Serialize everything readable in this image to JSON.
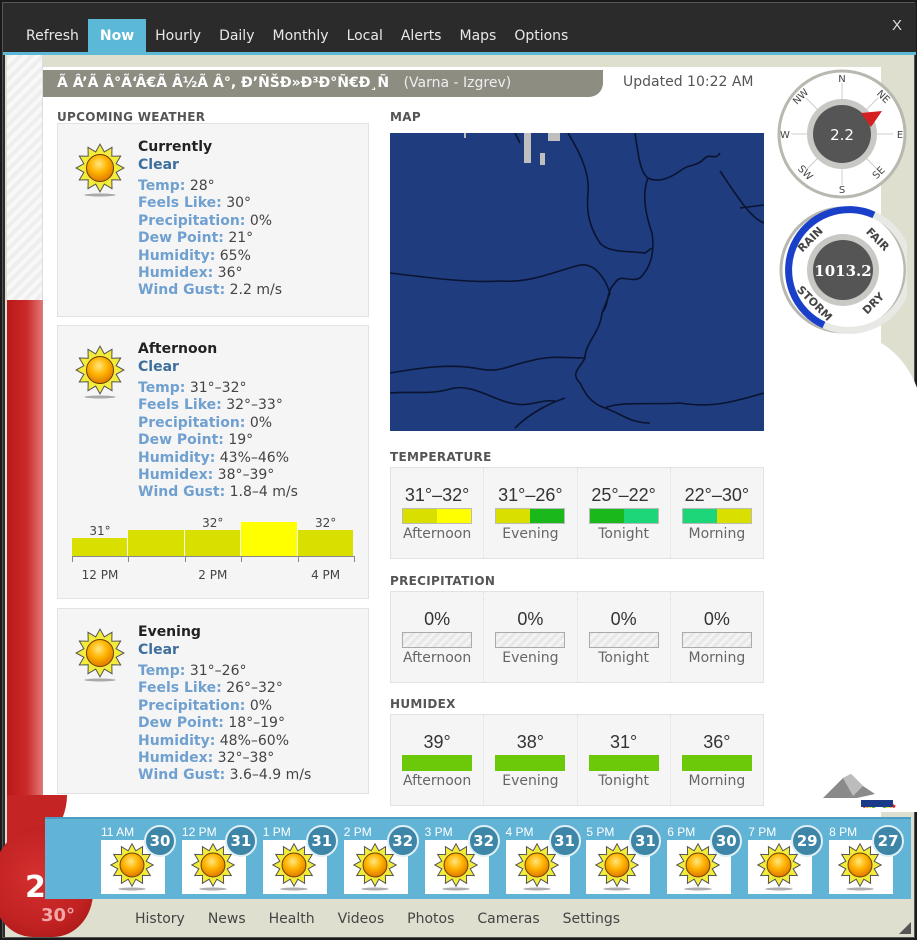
{
  "window": {
    "close_label": "X"
  },
  "nav": {
    "items": [
      {
        "label": "Refresh",
        "active": false
      },
      {
        "label": "Now",
        "active": true
      },
      {
        "label": "Hourly",
        "active": false
      },
      {
        "label": "Daily",
        "active": false
      },
      {
        "label": "Monthly",
        "active": false
      },
      {
        "label": "Local",
        "active": false
      },
      {
        "label": "Alerts",
        "active": false
      },
      {
        "label": "Maps",
        "active": false
      },
      {
        "label": "Options",
        "active": false
      }
    ]
  },
  "location": {
    "name": "Ã Â’Ã Â°Ã‘Â€Ã Â½Ã Â°, Ð’ÑŠÐ»Ð³Ð°Ñ€Ð¸Ñ",
    "sub": "(Varna - Izgrev)",
    "updated": "Updated 10:22 AM"
  },
  "current": {
    "temp": "28°",
    "feels_like": "30°"
  },
  "upcoming": {
    "title": "UPCOMING WEATHER",
    "cards": [
      {
        "period": "Currently",
        "condition": "Clear",
        "icon": "sun-icon",
        "rows": [
          {
            "label": "Temp:",
            "value": "28°"
          },
          {
            "label": "Feels Like:",
            "value": "30°"
          },
          {
            "label": "Precipitation:",
            "value": "0%"
          },
          {
            "label": "Dew Point:",
            "value": "21°"
          },
          {
            "label": "Humidity:",
            "value": "65%"
          },
          {
            "label": "Humidex:",
            "value": "36°"
          },
          {
            "label": "Wind Gust:",
            "value": "2.2 m/s"
          }
        ]
      },
      {
        "period": "Afternoon",
        "condition": "Clear",
        "icon": "sun-icon",
        "rows": [
          {
            "label": "Temp:",
            "value": "31°–32°"
          },
          {
            "label": "Feels Like:",
            "value": "32°–33°"
          },
          {
            "label": "Precipitation:",
            "value": "0%"
          },
          {
            "label": "Dew Point:",
            "value": "19°"
          },
          {
            "label": "Humidity:",
            "value": "43%–46%"
          },
          {
            "label": "Humidex:",
            "value": "38°–39°"
          },
          {
            "label": "Wind Gust:",
            "value": "1.8–4 m/s"
          }
        ],
        "hourly_bars": {
          "values": [
            31,
            32,
            32,
            33,
            32
          ],
          "labels": [
            "31°",
            "",
            "32°",
            "",
            "32°"
          ],
          "colors": [
            "#d9e000",
            "#d9e000",
            "#d9e000",
            "#ffff00",
            "#d9e000"
          ],
          "times": [
            "12 PM",
            "2 PM",
            "4 PM"
          ]
        }
      },
      {
        "period": "Evening",
        "condition": "Clear",
        "icon": "sun-icon",
        "rows": [
          {
            "label": "Temp:",
            "value": "31°–26°"
          },
          {
            "label": "Feels Like:",
            "value": "26°–32°"
          },
          {
            "label": "Precipitation:",
            "value": "0%"
          },
          {
            "label": "Dew Point:",
            "value": "18°–19°"
          },
          {
            "label": "Humidity:",
            "value": "48%–60%"
          },
          {
            "label": "Humidex:",
            "value": "32°–38°"
          },
          {
            "label": "Wind Gust:",
            "value": "3.6–4.9 m/s"
          }
        ]
      }
    ]
  },
  "map": {
    "title": "MAP"
  },
  "temperature": {
    "title": "TEMPERATURE",
    "cells": [
      {
        "value": "31°–32°",
        "label": "Afternoon",
        "colors": [
          "#d9e000",
          "#ffff00"
        ]
      },
      {
        "value": "31°–26°",
        "label": "Evening",
        "colors": [
          "#d9e000",
          "#1bb81b"
        ]
      },
      {
        "value": "25°–22°",
        "label": "Tonight",
        "colors": [
          "#1bb81b",
          "#1ed67a"
        ]
      },
      {
        "value": "22°–30°",
        "label": "Morning",
        "colors": [
          "#1ed67a",
          "#d9e000"
        ]
      }
    ]
  },
  "precipitation": {
    "title": "PRECIPITATION",
    "cells": [
      {
        "value": "0%",
        "label": "Afternoon"
      },
      {
        "value": "0%",
        "label": "Evening"
      },
      {
        "value": "0%",
        "label": "Tonight"
      },
      {
        "value": "0%",
        "label": "Morning"
      }
    ]
  },
  "humidex": {
    "title": "HUMIDEX",
    "cells": [
      {
        "value": "39°",
        "label": "Afternoon",
        "color": "#6cc90a"
      },
      {
        "value": "38°",
        "label": "Evening",
        "color": "#6cc90a"
      },
      {
        "value": "31°",
        "label": "Tonight",
        "color": "#6cc90a"
      },
      {
        "value": "36°",
        "label": "Morning",
        "color": "#6cc90a"
      }
    ]
  },
  "wind": {
    "speed": "2.2",
    "direction": "NE",
    "compass_labels": [
      "N",
      "NE",
      "E",
      "SE",
      "S",
      "SW",
      "W",
      "NW"
    ]
  },
  "pressure": {
    "value": "1013.2",
    "labels": [
      "RAIN",
      "FAIR",
      "STORM",
      "DRY"
    ]
  },
  "hourly": [
    {
      "time": "11 AM",
      "temp": "30",
      "icon": "sun-icon"
    },
    {
      "time": "12 PM",
      "temp": "31",
      "icon": "sun-icon"
    },
    {
      "time": "1 PM",
      "temp": "31",
      "icon": "sun-icon"
    },
    {
      "time": "2 PM",
      "temp": "32",
      "icon": "sun-icon"
    },
    {
      "time": "3 PM",
      "temp": "32",
      "icon": "sun-icon"
    },
    {
      "time": "4 PM",
      "temp": "31",
      "icon": "sun-icon"
    },
    {
      "time": "5 PM",
      "temp": "31",
      "icon": "sun-icon"
    },
    {
      "time": "6 PM",
      "temp": "30",
      "icon": "sun-icon"
    },
    {
      "time": "7 PM",
      "temp": "29",
      "icon": "sun-icon"
    },
    {
      "time": "8 PM",
      "temp": "27",
      "icon": "sun-icon"
    }
  ],
  "bottom_nav": [
    "History",
    "News",
    "Health",
    "Videos",
    "Photos",
    "Cameras",
    "Settings"
  ]
}
